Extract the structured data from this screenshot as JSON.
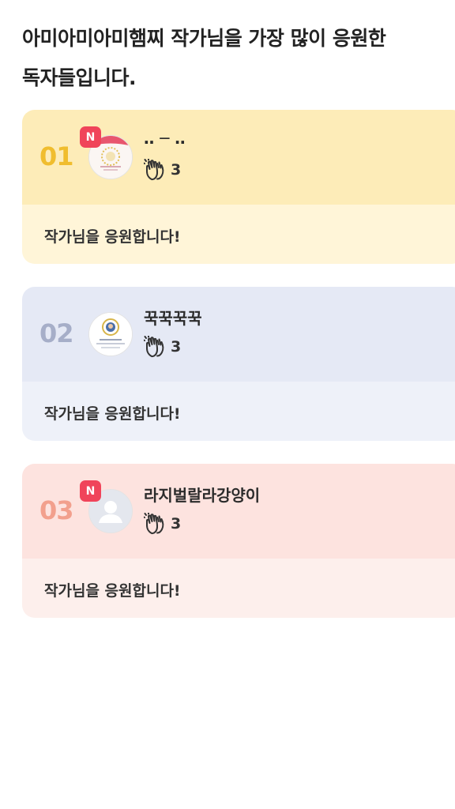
{
  "heading": "아미아미아미햄찌 작가님을 가장 많이 응원한\n독자들입니다.",
  "colors": {
    "card1_top": "#fdecb8",
    "card1_bottom": "#fff5d8",
    "card1_rank": "#f0bd2e",
    "card2_top": "#e5e9f5",
    "card2_bottom": "#eef1f9",
    "card2_rank": "#a6aec8",
    "card3_top": "#fde3df",
    "card3_bottom": "#fdefec",
    "card3_rank": "#f2a08d",
    "badge": "#f0445a"
  },
  "readers": [
    {
      "rank": "01",
      "name": "‥ ─ ‥",
      "claps": "3",
      "message": "작가님을 응원합니다!",
      "badge": "N",
      "avatar_icon": "profile-photo-cake"
    },
    {
      "rank": "02",
      "name": "꾹꾹꾹꾹",
      "claps": "3",
      "message": "작가님을 응원합니다!",
      "avatar_icon": "profile-photo-emblem"
    },
    {
      "rank": "03",
      "name": "라지벌랄라강양이",
      "claps": "3",
      "message": "작가님을 응원합니다!",
      "badge": "N",
      "avatar_icon": "default-user-icon"
    }
  ]
}
